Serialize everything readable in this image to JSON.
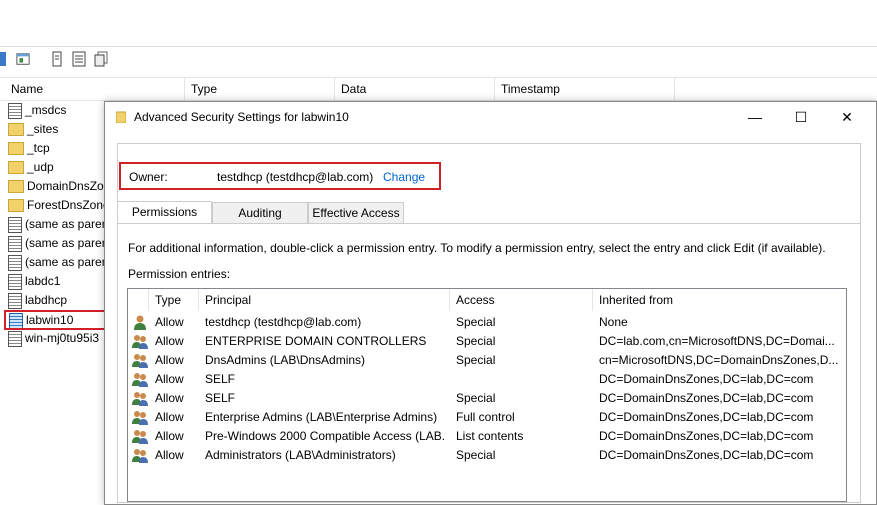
{
  "colors": {
    "accent": "#0066cc",
    "highlight_border": "#d0202a"
  },
  "list": {
    "columns": [
      "Name",
      "Type",
      "Data",
      "Timestamp"
    ],
    "items": [
      {
        "name": "_msdcs",
        "icon": "zone-doc-icon"
      },
      {
        "name": "_sites",
        "icon": "folder-icon"
      },
      {
        "name": "_tcp",
        "icon": "folder-icon"
      },
      {
        "name": "_udp",
        "icon": "folder-icon"
      },
      {
        "name": "DomainDnsZo",
        "icon": "folder-icon"
      },
      {
        "name": "ForestDnsZone",
        "icon": "folder-icon"
      },
      {
        "name": "(same as paren",
        "icon": "record-icon"
      },
      {
        "name": "(same as paren",
        "icon": "record-icon"
      },
      {
        "name": "(same as paren",
        "icon": "record-icon"
      },
      {
        "name": "labdc1",
        "icon": "record-icon"
      },
      {
        "name": "labdhcp",
        "icon": "record-icon"
      },
      {
        "name": "labwin10",
        "icon": "record-icon"
      },
      {
        "name": "win-mj0tu95i3",
        "icon": "record-icon"
      }
    ]
  },
  "dialog": {
    "title": "Advanced Security Settings for labwin10",
    "minimize": "—",
    "maximize": "☐",
    "close": "✕",
    "owner_label": "Owner:",
    "owner_value": "testdhcp (testdhcp@lab.com)",
    "owner_change": "Change",
    "tabs": [
      "Permissions",
      "Auditing",
      "Effective Access"
    ],
    "info_text": "For additional information, double-click a permission entry. To modify a permission entry, select the entry and click Edit (if available).",
    "entries_label": "Permission entries:",
    "table_headers": [
      "Type",
      "Principal",
      "Access",
      "Inherited from"
    ],
    "rows": [
      {
        "type": "Allow",
        "principal": "testdhcp (testdhcp@lab.com)",
        "access": "Special",
        "inherited": "None",
        "icon": "user-icon"
      },
      {
        "type": "Allow",
        "principal": "ENTERPRISE DOMAIN CONTROLLERS",
        "access": "Special",
        "inherited": "DC=lab.com,cn=MicrosoftDNS,DC=Domai...",
        "icon": "group-icon"
      },
      {
        "type": "Allow",
        "principal": "DnsAdmins (LAB\\DnsAdmins)",
        "access": "Special",
        "inherited": "cn=MicrosoftDNS,DC=DomainDnsZones,D...",
        "icon": "group-icon"
      },
      {
        "type": "Allow",
        "principal": "SELF",
        "access": "",
        "inherited": "DC=DomainDnsZones,DC=lab,DC=com",
        "icon": "group-icon"
      },
      {
        "type": "Allow",
        "principal": "SELF",
        "access": "Special",
        "inherited": "DC=DomainDnsZones,DC=lab,DC=com",
        "icon": "group-icon"
      },
      {
        "type": "Allow",
        "principal": "Enterprise Admins (LAB\\Enterprise Admins)",
        "access": "Full control",
        "inherited": "DC=DomainDnsZones,DC=lab,DC=com",
        "icon": "group-icon"
      },
      {
        "type": "Allow",
        "principal": "Pre-Windows 2000 Compatible Access (LAB...",
        "access": "List contents",
        "inherited": "DC=DomainDnsZones,DC=lab,DC=com",
        "icon": "group-icon"
      },
      {
        "type": "Allow",
        "principal": "Administrators (LAB\\Administrators)",
        "access": "Special",
        "inherited": "DC=DomainDnsZones,DC=lab,DC=com",
        "icon": "group-icon"
      }
    ]
  }
}
